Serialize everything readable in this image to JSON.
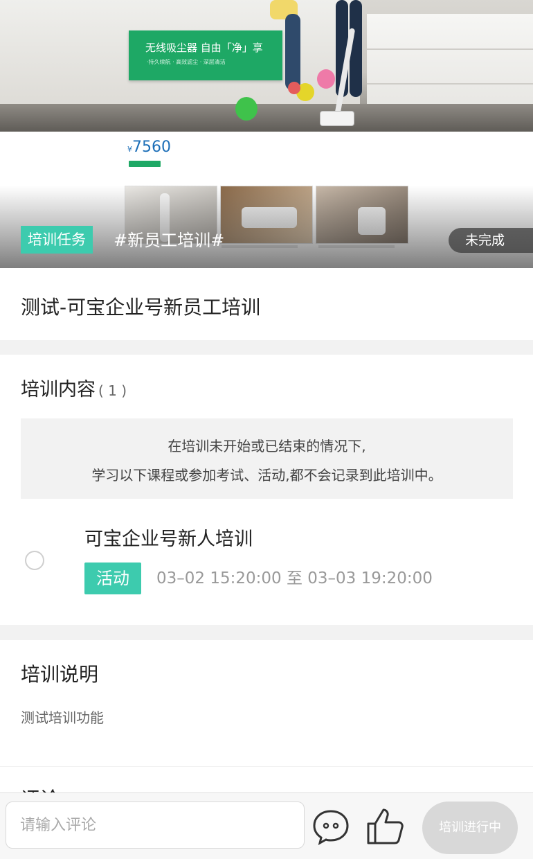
{
  "banner": {
    "card_title": "无线吸尘器 自由「净」享",
    "card_subtitle": "·持久续航 · 高效滤尘 · 深层清洁",
    "price_currency": "¥",
    "price_value": "7560",
    "tag_label": "培训任务",
    "topic": "#新员工培训#",
    "status": "未完成"
  },
  "training": {
    "title": "测试-可宝企业号新员工培训"
  },
  "content": {
    "heading": "培训内容",
    "count": "( 1 )",
    "notice_line1": "在培训未开始或已结束的情况下,",
    "notice_line2": "学习以下课程或参加考试、活动,都不会记录到此培训中。",
    "items": [
      {
        "title": "可宝企业号新人培训",
        "badge": "活动",
        "time": "03–02 15:20:00 至 03–03 19:20:00"
      }
    ]
  },
  "description": {
    "heading": "培训说明",
    "text": "测试培训功能"
  },
  "comments": {
    "heading": "评论"
  },
  "bottom_bar": {
    "input_placeholder": "请输入评论",
    "chat_icon": "chat-bubble-icon",
    "like_icon": "thumbs-up-icon",
    "status_button": "培训进行中"
  },
  "colors": {
    "accent": "#3dcbae",
    "background": "#f2f2f2",
    "muted_text": "#999999"
  }
}
